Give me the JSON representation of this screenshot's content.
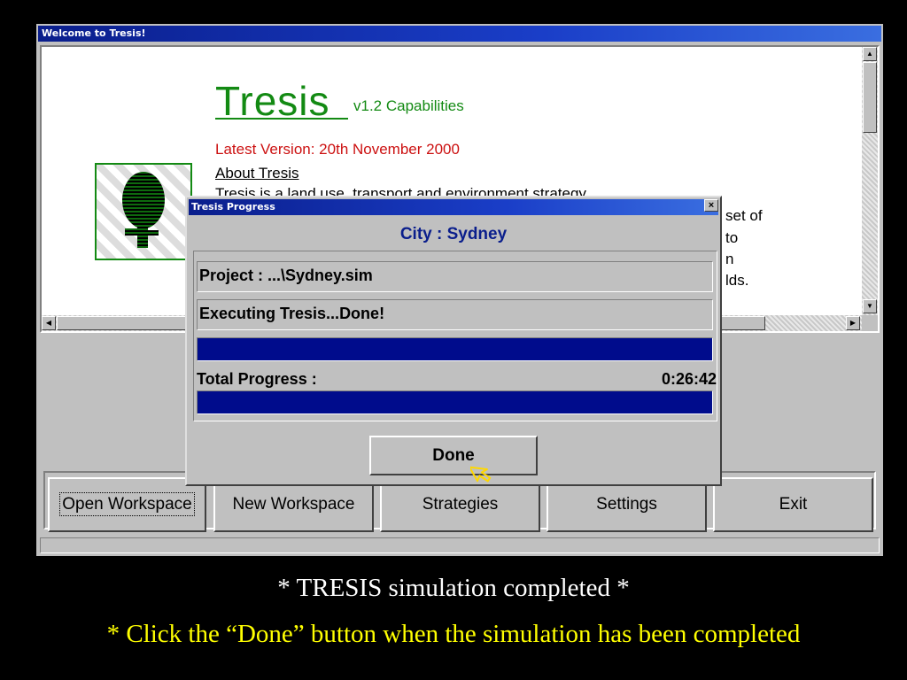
{
  "window": {
    "title": "Welcome to Tresis!"
  },
  "content": {
    "brand": "Tresis",
    "version": "v1.2 Capabilities",
    "latest": "Latest Version: 20th November 2000",
    "about": "About Tresis",
    "description": "Tresis is a land use, transport and environment strategy",
    "fragments": [
      "set of",
      "to",
      "n",
      "lds."
    ]
  },
  "buttons": {
    "open_workspace": "Open Workspace",
    "new_workspace": "New Workspace",
    "strategies": "Strategies",
    "settings": "Settings",
    "exit": "Exit"
  },
  "dialog": {
    "title": "Tresis Progress",
    "close": "×",
    "city": "City : Sydney",
    "project": "Project : ...\\Sydney.sim",
    "status": "Executing Tresis...Done!",
    "step_progress": 1.0,
    "total_label": "Total Progress :",
    "total_time": "0:26:42",
    "total_progress": 1.0,
    "done_button": "Done"
  },
  "captions": {
    "line1": "* TRESIS simulation completed *",
    "line2": "* Click the “Done” button when the simulation has been completed"
  },
  "colors": {
    "title_blue": "#0a1e8c",
    "brand_green": "#138a13",
    "latest_red": "#cc1111",
    "progress_blue": "#000c8c",
    "caption_yellow": "#ffff00"
  }
}
